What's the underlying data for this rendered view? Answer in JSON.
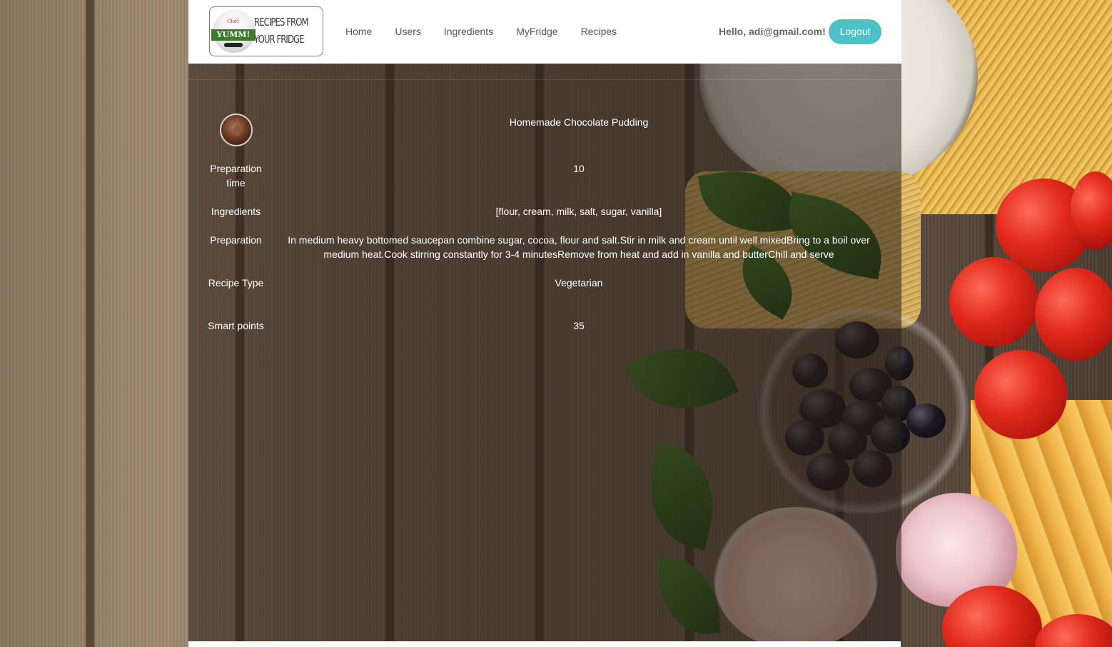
{
  "brand": {
    "logo_line1": "RECIPES FROM",
    "logo_line2": "YOUR FRIDGE",
    "logo_badge": "YUMM!",
    "logo_chef": "Chef"
  },
  "nav": {
    "items": [
      {
        "label": "Home"
      },
      {
        "label": "Users"
      },
      {
        "label": "Ingredients"
      },
      {
        "label": "MyFridge"
      },
      {
        "label": "Recipes"
      }
    ],
    "greeting": "Hello, adi@gmail.com!",
    "logout_label": "Logout"
  },
  "recipe": {
    "name": "Homemade Chocolate Pudding",
    "image": "chocolate-pudding-image",
    "fields": {
      "prep_time_label": "Preparation time",
      "prep_time_value": "10",
      "ingredients_label": "Ingredients",
      "ingredients_value": "[flour, cream, milk, salt, sugar, vanilla]",
      "preparation_label": "Preparation",
      "preparation_value": "In medium heavy bottomed saucepan combine sugar, cocoa, flour and salt.Stir in milk and cream until well mixedBring to a boil over medium heat.Cook stirring constantly for 3-4 minutesRemove from heat and add in vanilla and butterChill and serve",
      "type_label": "Recipe Type",
      "type_value": "Vegetarian",
      "points_label": "Smart points",
      "points_value": "35"
    }
  },
  "colors": {
    "accent": "#4cc1c6",
    "navbar": "#ffffff",
    "panel_overlay": "rgba(40,30,22,0.55)"
  }
}
